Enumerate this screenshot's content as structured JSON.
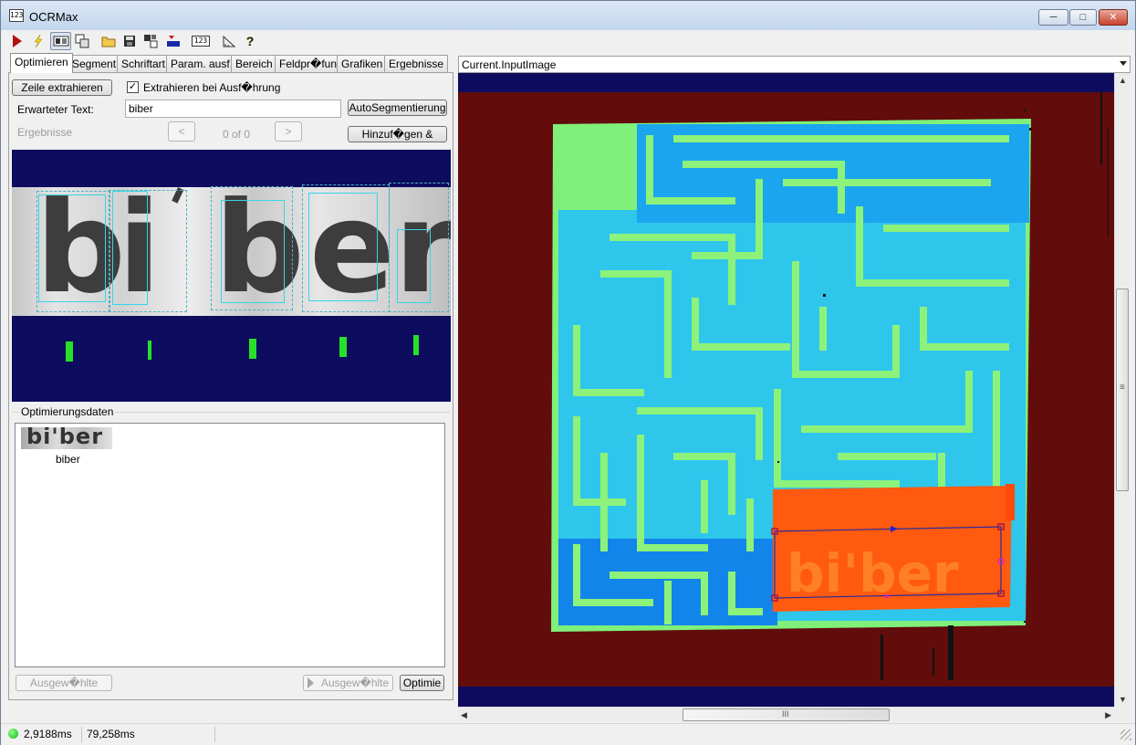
{
  "window": {
    "title": "OCRMax",
    "app_icon_text": "123"
  },
  "toolbar": {
    "icons": [
      "run-icon",
      "lightning-icon",
      "ocr-settings-icon",
      "image-copy-icon",
      "open-folder-icon",
      "save-icon",
      "export-icon",
      "import-icon",
      "font-123-icon",
      "measure-icon",
      "help-icon"
    ],
    "font_icon_text": "123",
    "help_icon_text": "?"
  },
  "tabs": [
    {
      "label": "Optimieren"
    },
    {
      "label": "Segment"
    },
    {
      "label": "Schriftart"
    },
    {
      "label": "Param. ausf."
    },
    {
      "label": "Bereich"
    },
    {
      "label": "Feldpr�fung"
    },
    {
      "label": "Grafiken"
    },
    {
      "label": "Ergebnisse"
    }
  ],
  "optimize": {
    "extract_line_button": "Zeile extrahieren",
    "extract_on_run_label": "Extrahieren bei Ausf�hrung",
    "extract_on_run_checked": true,
    "checkmark": "✓",
    "expected_text_label": "Erwarteter Text:",
    "expected_text_value": "biber",
    "auto_segment_button": "AutoSegmentierung",
    "results_label": "Ergebnisse",
    "prev_button": "<",
    "next_button": ">",
    "page_counter": "0 of 0",
    "add_button": "Hinzuf�gen &",
    "preview_glyphs": [
      "b",
      "i",
      "b",
      "e",
      "r"
    ],
    "preview_mark": "'",
    "optimization_group_title": "Optimierungsdaten",
    "list_items": [
      {
        "thumb_text": "bi'ber",
        "label": "biber"
      }
    ],
    "selected_button_1": "Ausgew�hlte",
    "selected_button_2": "Ausgew�hlte",
    "optimize_button": "Optimie"
  },
  "viewer": {
    "image_combo_value": "Current.InputImage",
    "overlay_text": "bi'ber",
    "hscroll_grip": "III",
    "vscroll_grip": "≡",
    "colors": {
      "background": "#620c0c",
      "maze_fill": "#18a6ec",
      "maze_wall": "#7ff07a",
      "target": "#ff5a10"
    }
  },
  "status": {
    "indicator": "green",
    "time1": "2,9188ms",
    "time2": "79,258ms"
  },
  "colors": {
    "accent": "#0d0c5e",
    "glyph_bar": "#27e02a",
    "box": "#35d7e6"
  }
}
